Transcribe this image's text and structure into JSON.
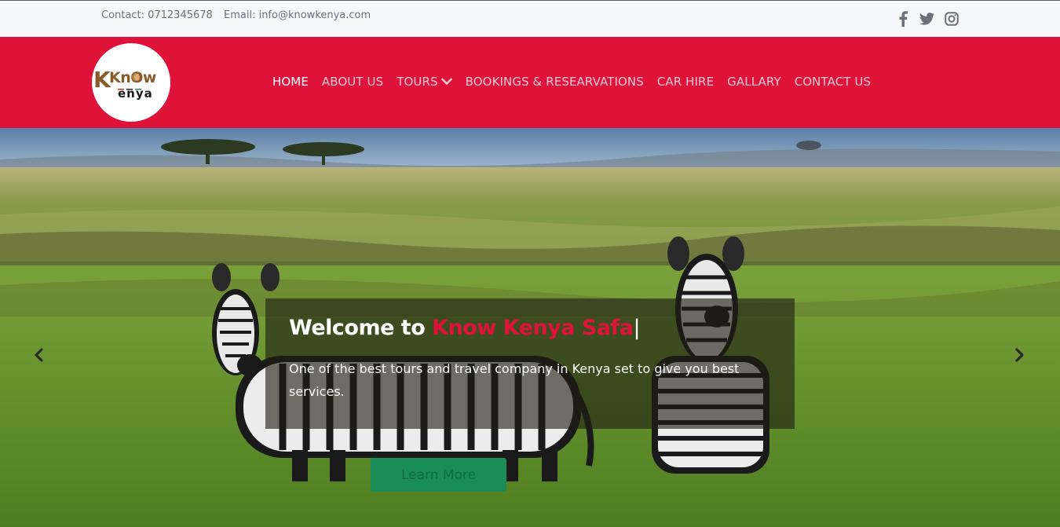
{
  "topbar": {
    "phone": "Contact: 0712345678",
    "email": "Email: info@knowkenya.com",
    "social": [
      "facebook-icon",
      "twitter-icon",
      "instagram-icon"
    ]
  },
  "header": {
    "logo_line1": "KnOw",
    "logo_line2": "enya",
    "logo_k": "K",
    "nav": [
      "HOME",
      "ABOUT US",
      "TOURS",
      "BOOKINGS & RESEARVATIONS",
      "CAR HIRE",
      "GALLARY",
      "CONTACT US"
    ],
    "active": "HOME"
  },
  "hero": {
    "title_prefix": "Welcome to ",
    "title_brand": "Know Kenya Safa",
    "cursor": "|",
    "text": "One of the best tours and travel company in Kenya set to give you best services.",
    "button_label": "Learn More",
    "prev_icon": "chevron-left-icon",
    "next_icon": "chevron-right-icon"
  },
  "colors": {
    "brand_red": "#df1339",
    "topbar_bg": "#f7f8fa",
    "button_green": "#198c58"
  }
}
